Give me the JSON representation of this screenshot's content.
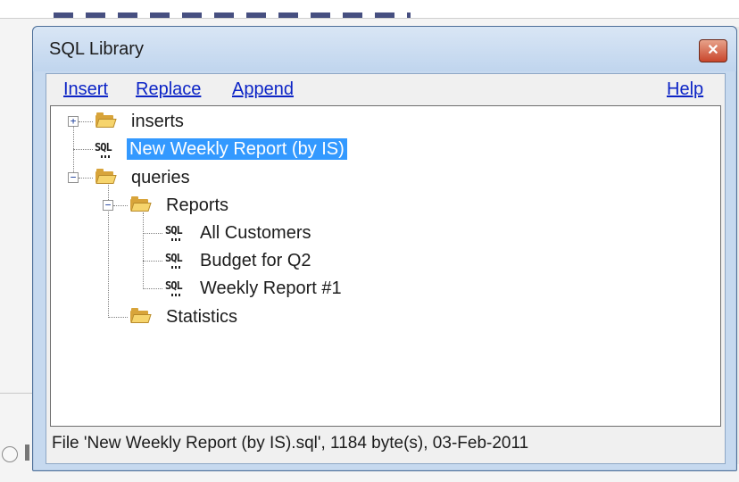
{
  "window": {
    "title": "SQL Library"
  },
  "icons": {
    "close": "close-icon",
    "folder": "folder-icon",
    "sql": "sql-file-icon",
    "expand": "plus-icon",
    "collapse": "minus-icon"
  },
  "menu": {
    "insert": "Insert",
    "replace": "Replace",
    "append": "Append",
    "help": "Help"
  },
  "tree": {
    "inserts": "inserts",
    "new_weekly_report": "New Weekly Report (by IS)",
    "queries": "queries",
    "reports": "Reports",
    "all_customers": "All Customers",
    "budget_q2": "Budget for Q2",
    "weekly_report_1": "Weekly Report #1",
    "statistics": "Statistics",
    "sql_glyph": "SQL",
    "plus_glyph": "+",
    "minus_glyph": "−"
  },
  "status": {
    "text": "File 'New Weekly Report (by IS).sql', 1184 byte(s), 03-Feb-2011"
  },
  "colors": {
    "selection": "#3399ff",
    "link": "#0c24c6",
    "title_bar": "#c6d9ef",
    "close_button": "#c9462c"
  }
}
